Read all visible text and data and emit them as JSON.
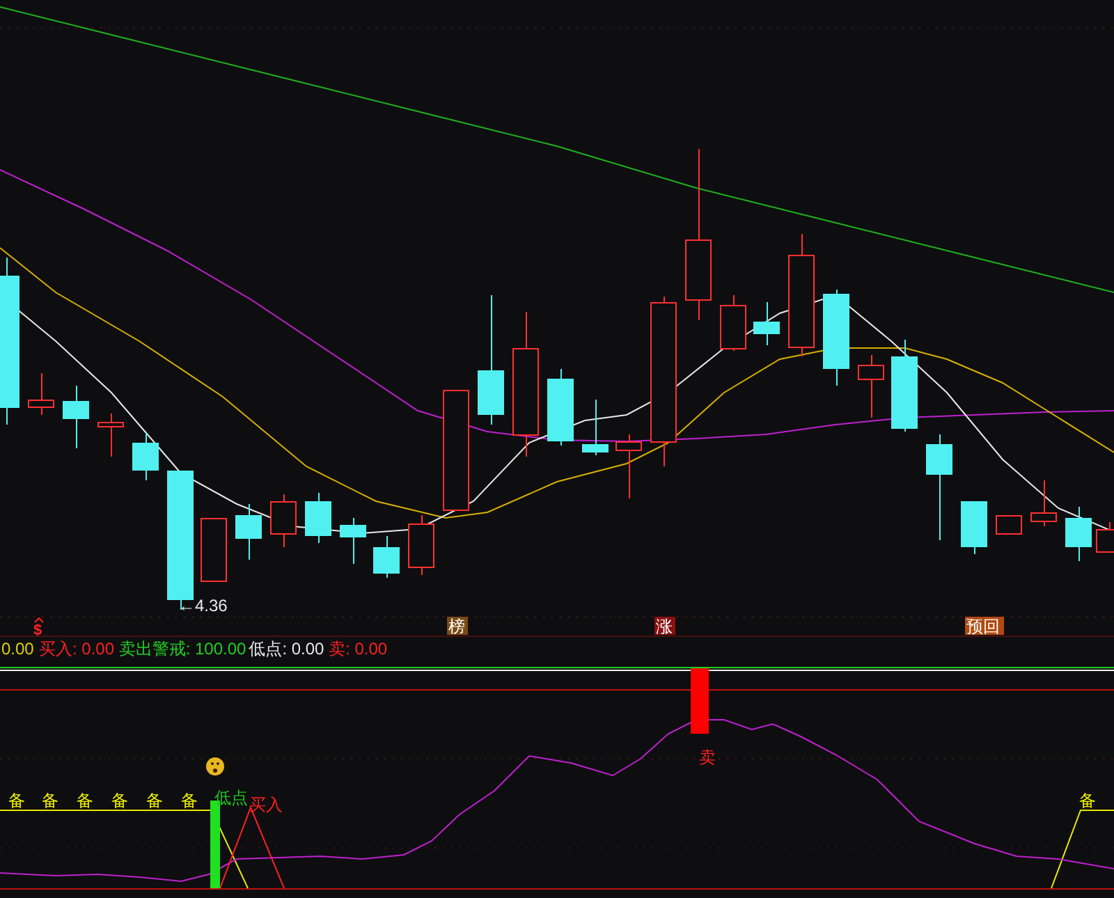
{
  "main_chart": {
    "low_label": "←4.36",
    "markers": [
      {
        "kind": "dollar",
        "text": "$"
      },
      {
        "kind": "tag",
        "text": "榜",
        "color": "#7a4a14"
      },
      {
        "kind": "tag",
        "text": "涨",
        "color": "#8a1010"
      },
      {
        "kind": "tag",
        "text": "预回",
        "color": "#b04a10"
      }
    ]
  },
  "legend": [
    {
      "text": "0.00",
      "color": "#e0d000"
    },
    {
      "text": "买入: 0.00",
      "color": "#ff2020"
    },
    {
      "text": "卖出警戒: 100.00",
      "color": "#20d020"
    },
    {
      "text": "低点: 0.00",
      "color": "#e8e8e8"
    },
    {
      "text": "卖: 0.00",
      "color": "#ff2020"
    }
  ],
  "indicator": {
    "prep_labels": [
      "备",
      "备",
      "备",
      "备",
      "备",
      "备",
      "备"
    ],
    "low_label": "低点",
    "buy_label": "买入",
    "sell_label": "卖"
  }
}
